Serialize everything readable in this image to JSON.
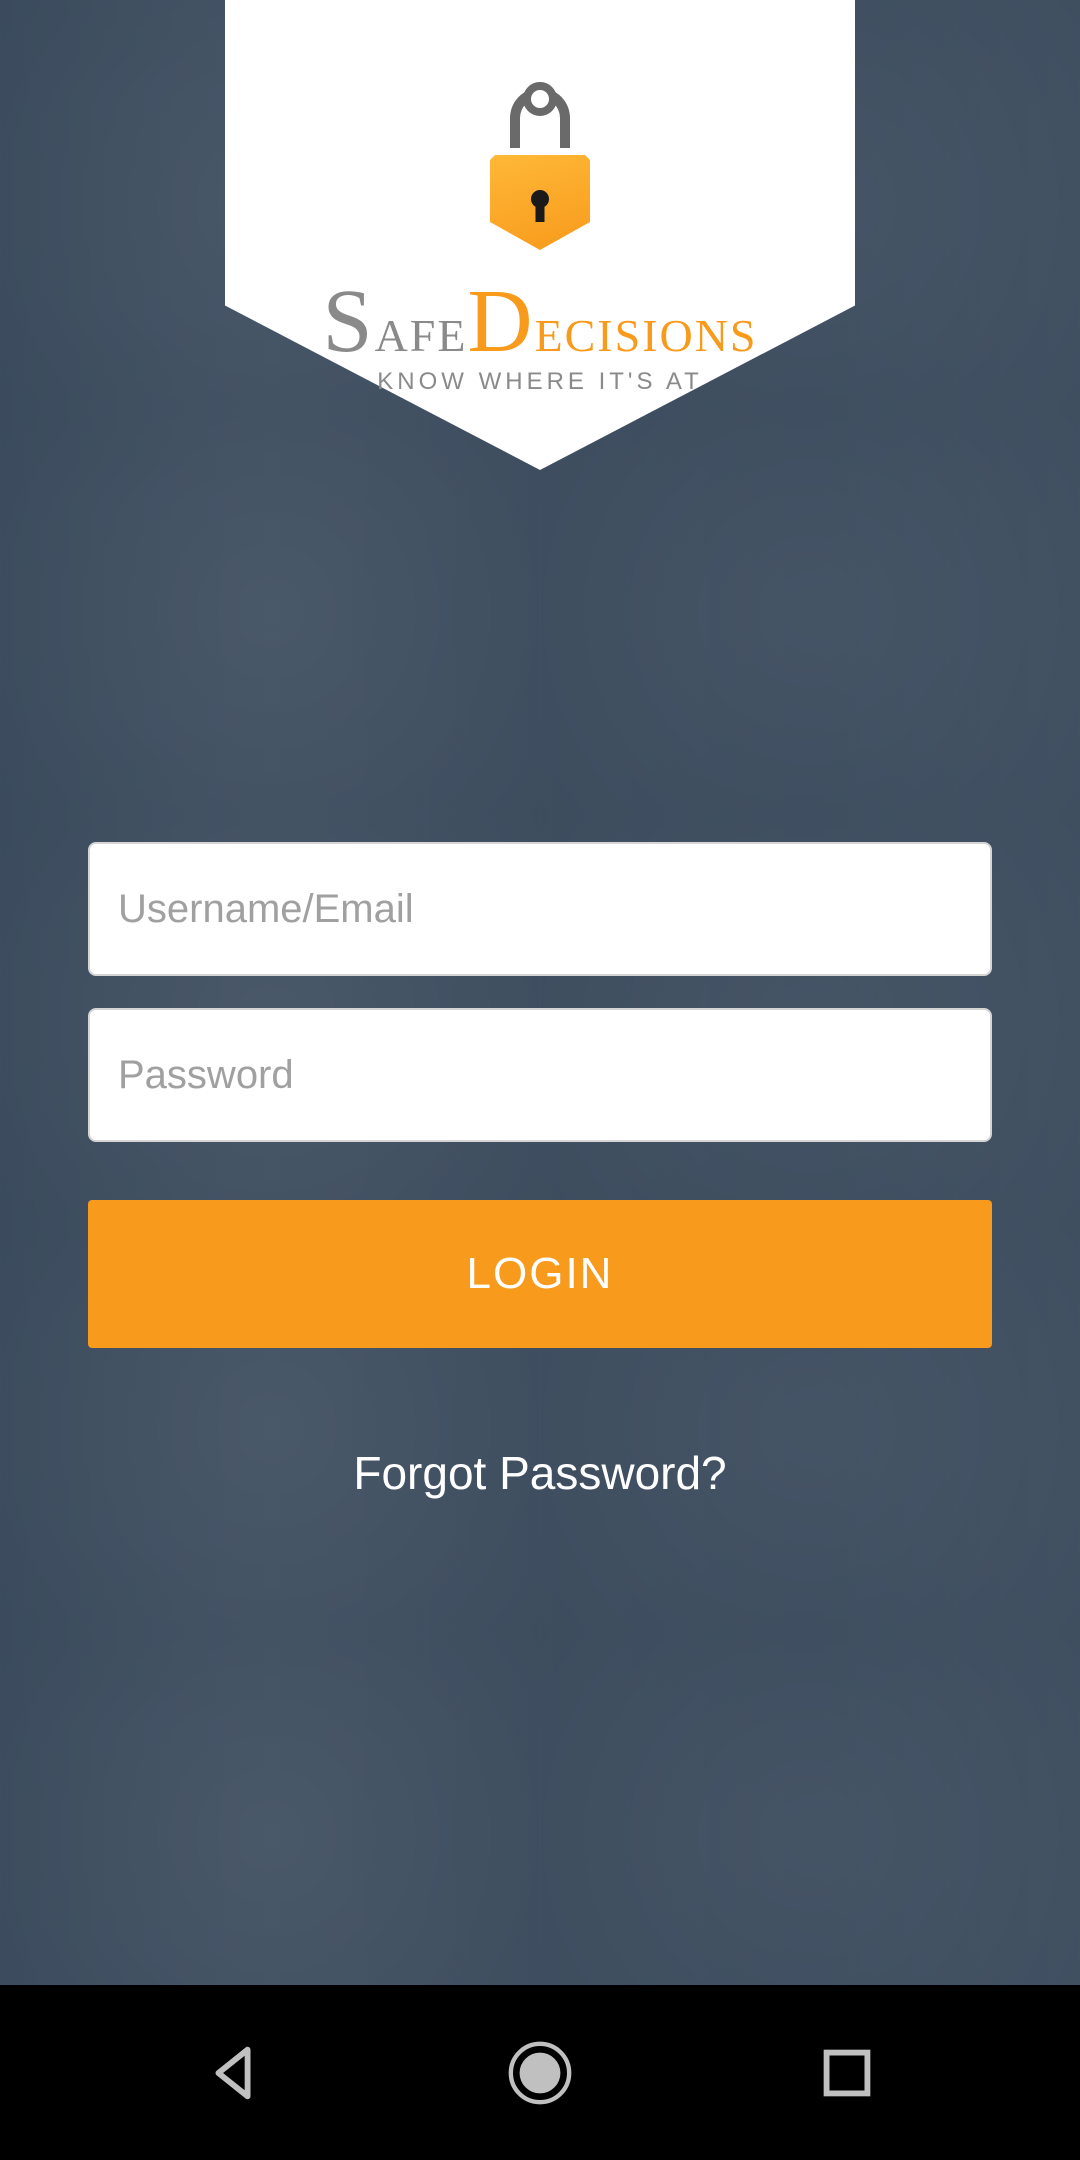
{
  "brand": {
    "name_part1": "Safe",
    "name_part2": "Decisions",
    "tagline": "KNOW WHERE IT'S AT"
  },
  "form": {
    "username_placeholder": "Username/Email",
    "username_value": "",
    "password_placeholder": "Password",
    "password_value": "",
    "login_label": "LOGIN",
    "forgot_label": "Forgot Password?"
  },
  "colors": {
    "accent": "#f89a1c",
    "overlay": "#1f2f42"
  }
}
